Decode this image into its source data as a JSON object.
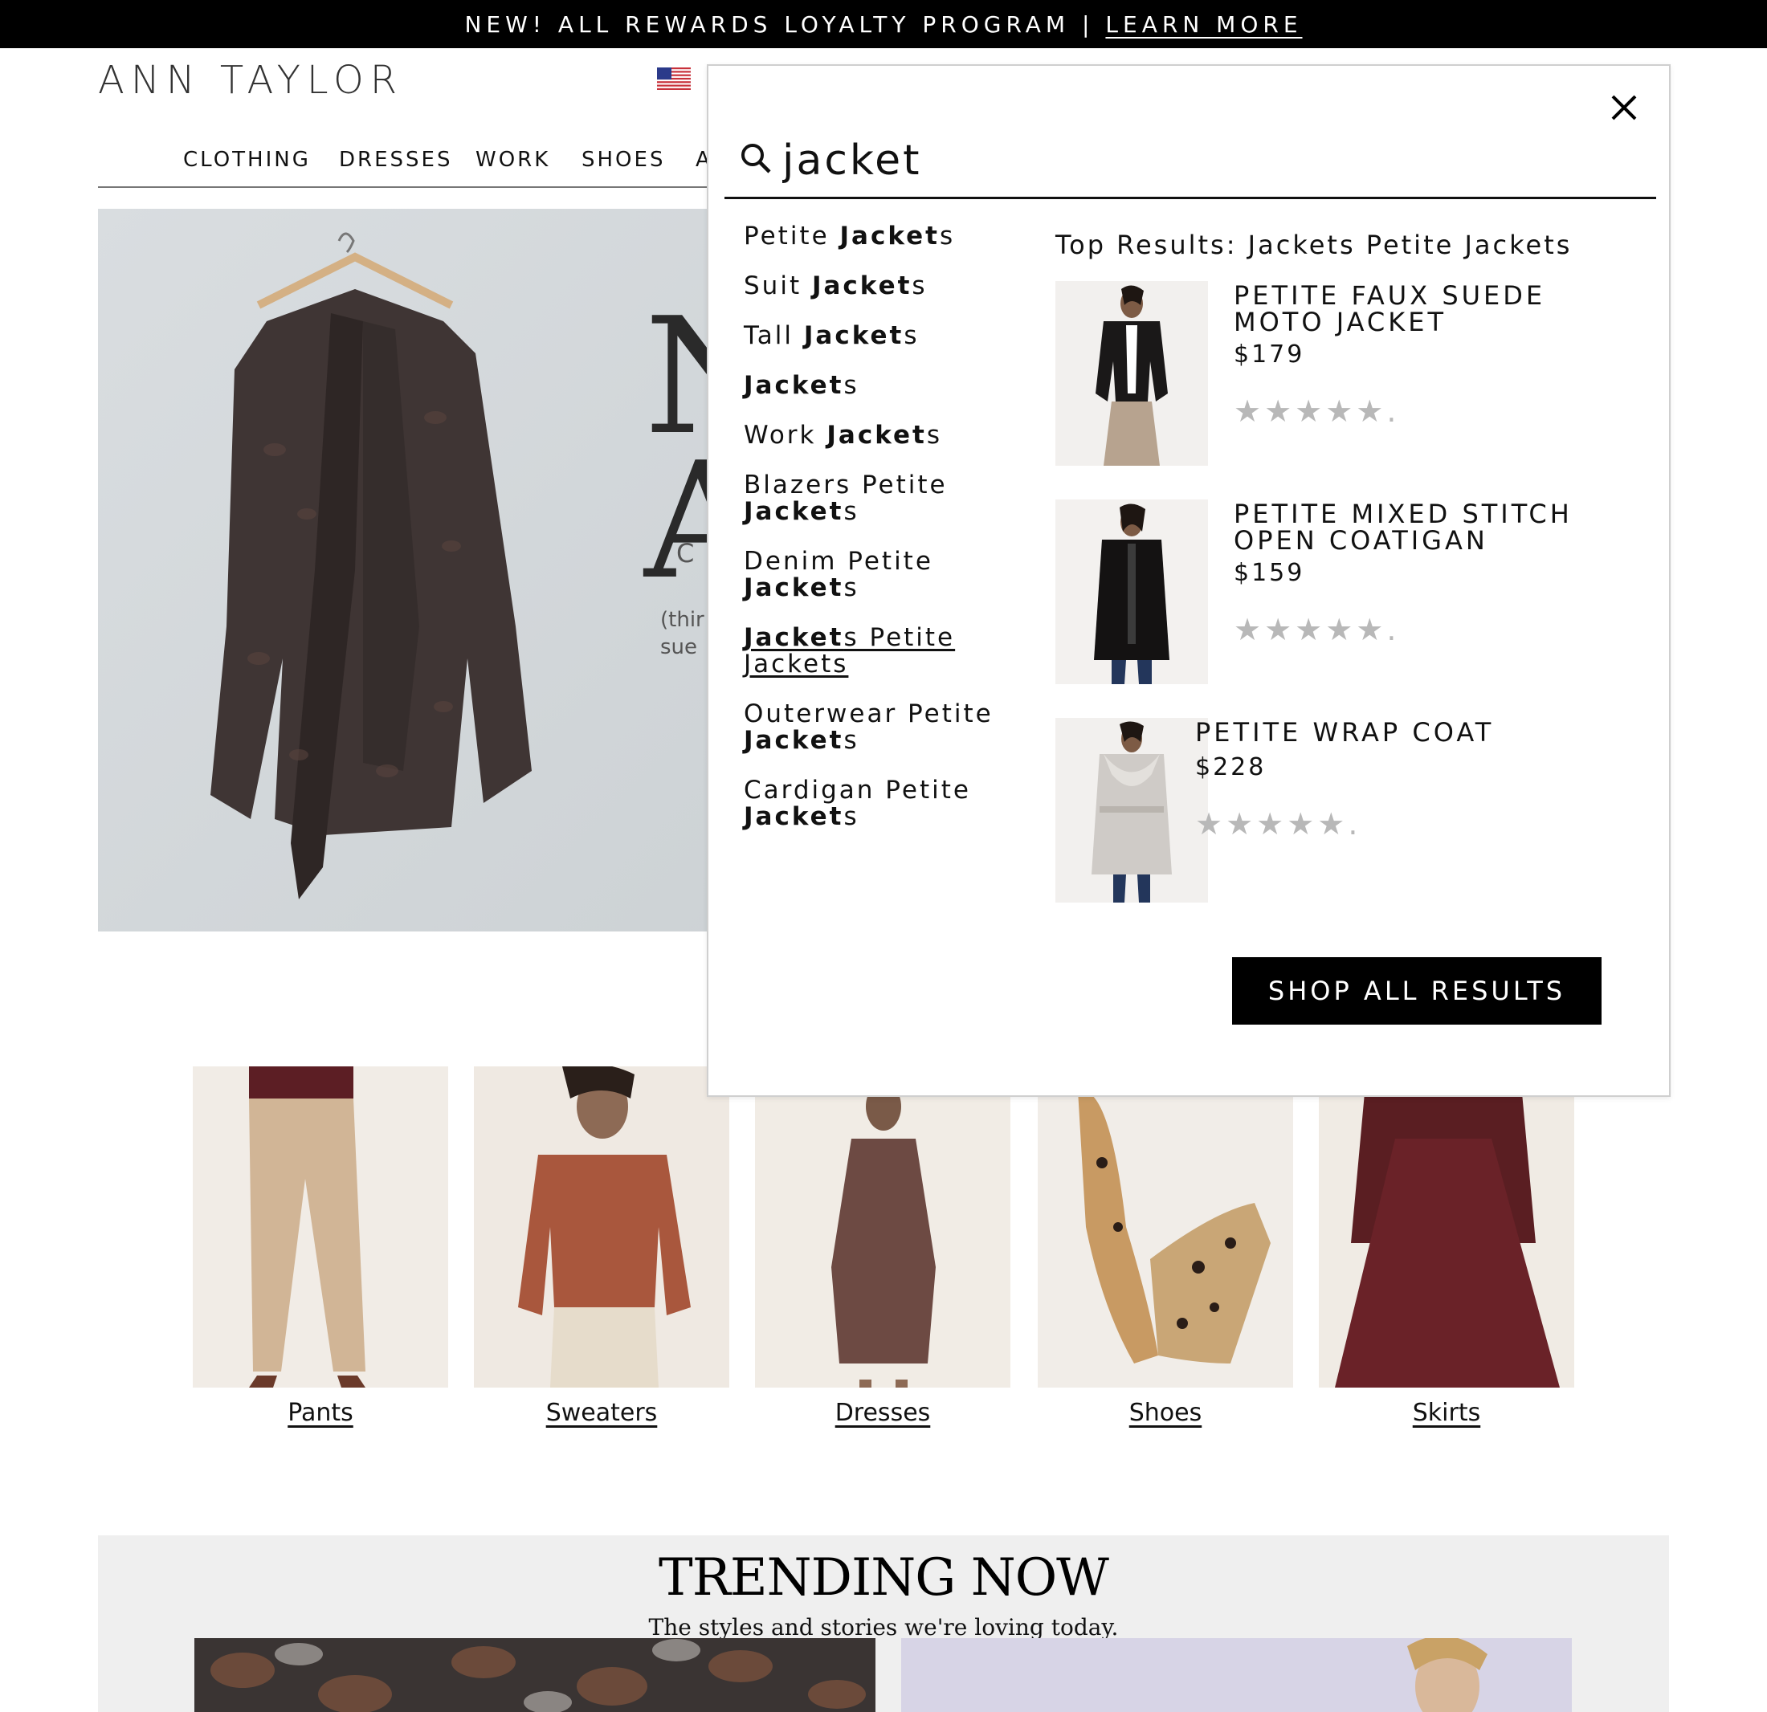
{
  "promo": {
    "text": "NEW! ALL REWARDS LOYALTY PROGRAM |",
    "link": "LEARN MORE"
  },
  "header": {
    "logo": "ANN TAYLOR",
    "nav": [
      "CLOTHING",
      "DRESSES",
      "WORK",
      "SHOES",
      "A"
    ]
  },
  "hero": {
    "headline_1": "N",
    "headline_2": "A",
    "sub": "C",
    "small_1": "(thir",
    "small_2": "sue"
  },
  "categories": [
    "Pants",
    "Sweaters",
    "Dresses",
    "Shoes",
    "Skirts"
  ],
  "trending": {
    "title": "TRENDING NOW",
    "subtitle": "The styles and stories we're loving today."
  },
  "search": {
    "query": "jacket",
    "suggestions": [
      {
        "pre": "Petite ",
        "bold": "Jacket",
        "post": "s"
      },
      {
        "pre": "Suit ",
        "bold": "Jacket",
        "post": "s"
      },
      {
        "pre": "Tall ",
        "bold": "Jacket",
        "post": "s"
      },
      {
        "pre": "",
        "bold": "Jacket",
        "post": "s"
      },
      {
        "pre": "Work ",
        "bold": "Jacket",
        "post": "s"
      },
      {
        "pre": "Blazers Petite ",
        "bold": "Jacket",
        "post": "s"
      },
      {
        "pre": "Denim Petite ",
        "bold": "Jacket",
        "post": "s"
      },
      {
        "pre": "",
        "bold": "Jacket",
        "post": "s Petite Jackets"
      },
      {
        "pre": "Outerwear Petite ",
        "bold": "Jacket",
        "post": "s"
      },
      {
        "pre": "Cardigan Petite ",
        "bold": "Jacket",
        "post": "s"
      }
    ],
    "results_title": "Top Results: Jackets Petite Jackets",
    "results": [
      {
        "name": "PETITE FAUX SUEDE MOTO JACKET",
        "price": "$179",
        "stars": "★★★★★."
      },
      {
        "name": "PETITE MIXED STITCH OPEN COATIGAN",
        "price": "$159",
        "stars": "★★★★★."
      },
      {
        "name": "PETITE WRAP COAT",
        "price": "$228",
        "stars": "★★★★★."
      }
    ],
    "shop_all": "SHOP ALL RESULTS"
  },
  "icons": {
    "search": "search-icon",
    "close": "close-icon",
    "flag": "us-flag-icon"
  },
  "colors": {
    "promo_bg": "#000000",
    "button_bg": "#000000",
    "star": "#b8b8b8"
  }
}
